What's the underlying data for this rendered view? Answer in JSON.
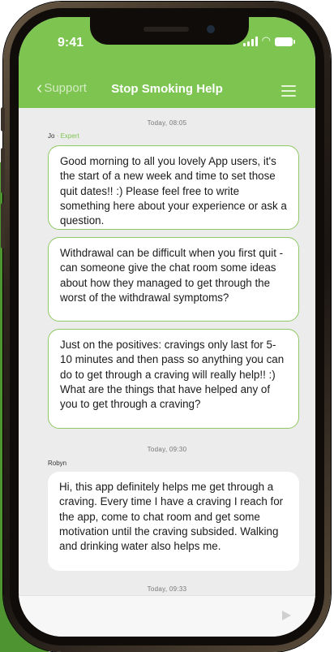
{
  "status_bar": {
    "time": "9:41"
  },
  "nav": {
    "back_label": "Support",
    "title": "Stop Smoking Help"
  },
  "messages": [
    {
      "timestamp": "Today, 08:05",
      "sender": "Jo",
      "role": "Expert",
      "paragraphs": [
        "Good morning to all you lovely App users, it's the start of a new week and time to set those quit dates!! :) Please feel free to write something here about your experience or ask a question.",
        "Withdrawal can be difficult when you first quit - can someone give the chat room some ideas about how they managed to get through the worst of the withdrawal symptoms?",
        "Just on the positives: cravings only last for 5- 10 minutes and then pass so anything you can do to get through a craving will really help!! :) What are the things that have helped any of you to get through a craving?"
      ]
    },
    {
      "timestamp": "Today, 09:30",
      "sender": "Robyn",
      "paragraphs": [
        "Hi, this app definitely helps me get through a craving. Every time I have a craving I reach for the app, come to chat room and get some motivation until the craving subsided. Walking and drinking water also helps me."
      ]
    }
  ],
  "last_timestamp": "Today, 09:33",
  "icons": {
    "back": "chevron-left-icon",
    "menu": "menu-icon",
    "send": "send-icon",
    "signal": "signal-icon",
    "wifi": "wifi-icon",
    "battery": "battery-icon"
  },
  "colors": {
    "brand_green": "#7dc451",
    "background_green": "#5aa23a",
    "expert_border": "#8fc864",
    "chat_bg": "#ececec"
  }
}
